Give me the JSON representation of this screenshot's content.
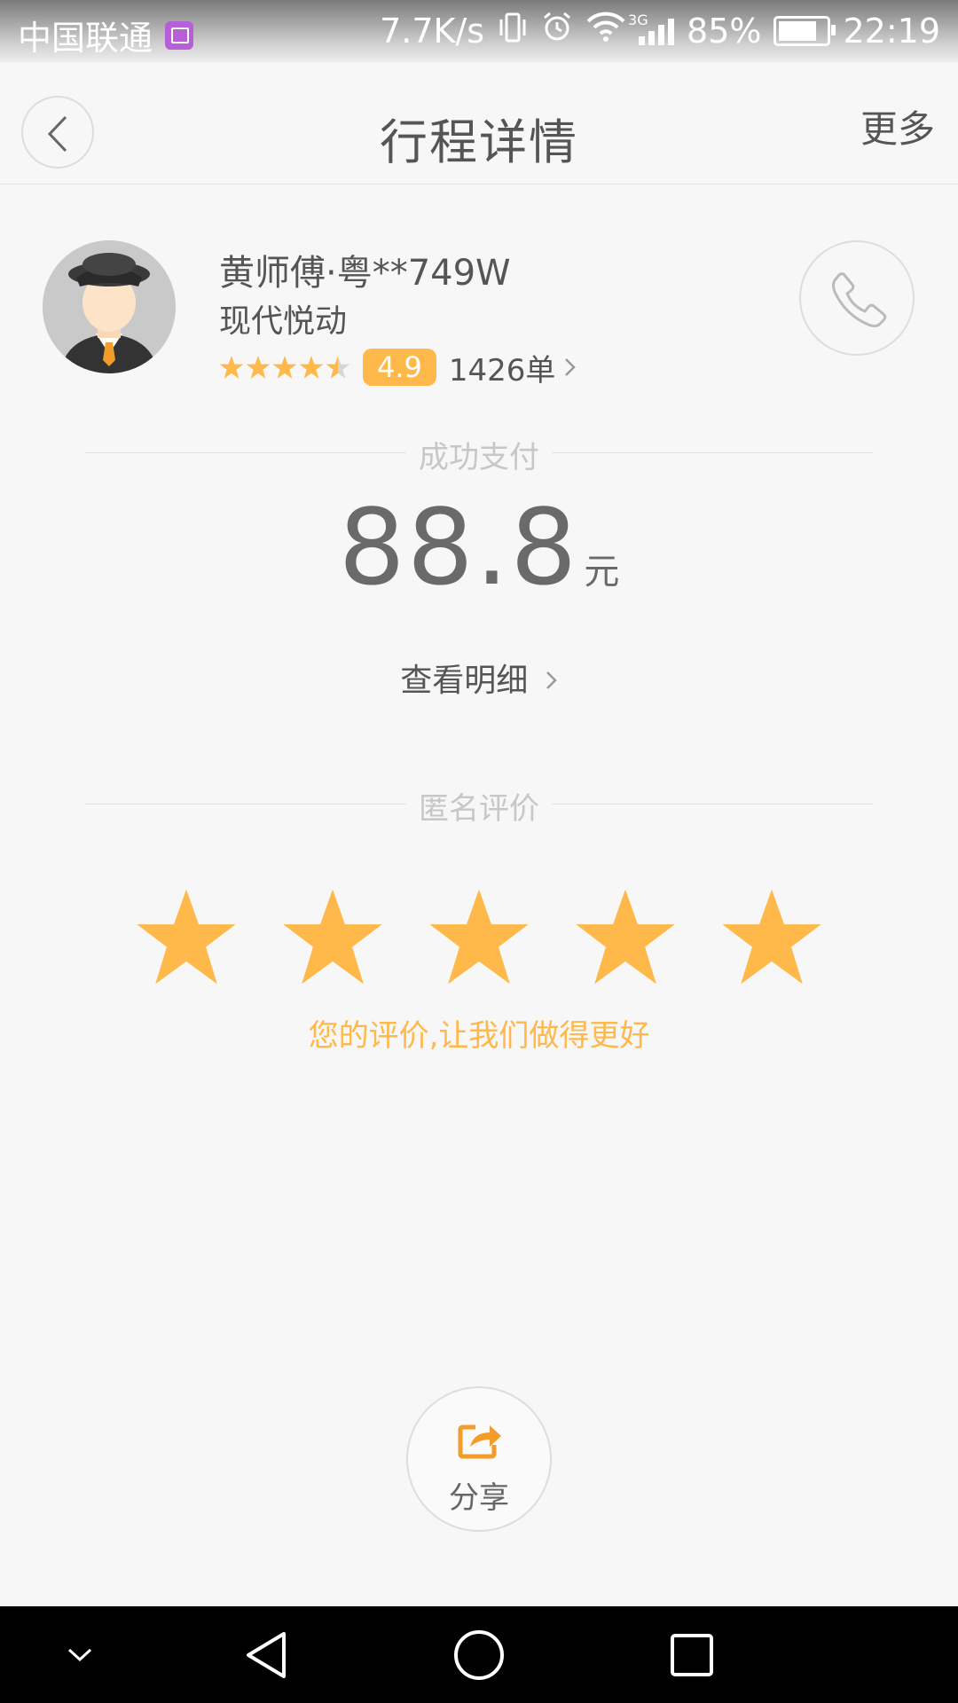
{
  "status_bar": {
    "carrier": "中国联通",
    "speed": "7.7K/s",
    "network": "3G",
    "battery": "85%",
    "time": "22:19",
    "icons": [
      "gallery-notification-icon",
      "vibrate-icon",
      "alarm-icon",
      "wifi-icon",
      "signal-icon",
      "battery-icon"
    ]
  },
  "header": {
    "title": "行程详情",
    "more_label": "更多",
    "back_icon": "chevron-left-icon"
  },
  "driver": {
    "name": "黄师傅·粤**749W",
    "car_model": "现代悦动",
    "star_rating": 4.5,
    "rating_value": "4.9",
    "orders": "1426单"
  },
  "payment": {
    "section_label": "成功支付",
    "amount": "88.8",
    "unit": "元",
    "detail_link": "查看明细"
  },
  "review": {
    "section_label": "匿名评价",
    "stars_filled": 5,
    "stars_total": 5,
    "hint": "您的评价,让我们做得更好"
  },
  "share": {
    "label": "分享"
  },
  "colors": {
    "accent": "#ffb84a",
    "text": "#555555",
    "muted": "#c7c7c7",
    "background": "#f7f7f7"
  }
}
